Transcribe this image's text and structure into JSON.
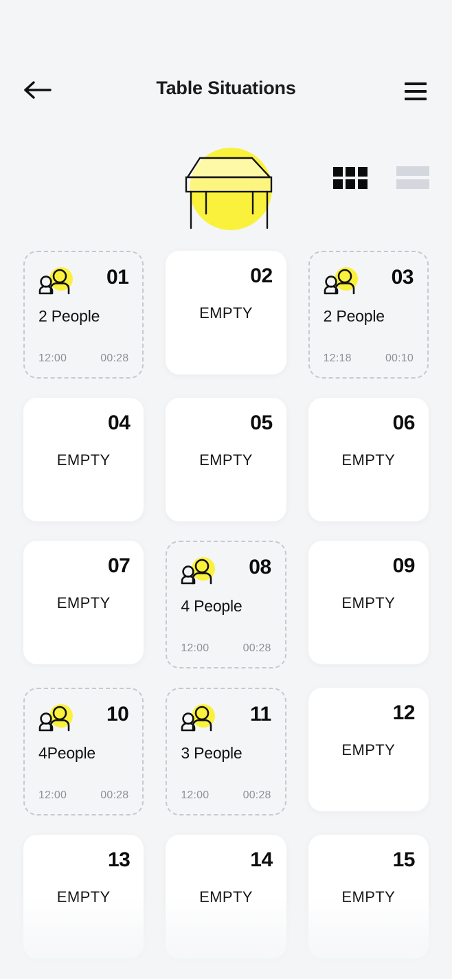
{
  "header": {
    "back_icon": "arrow-left-icon",
    "title": "Table Situations",
    "menu_icon": "hamburger-menu-icon"
  },
  "hero": {
    "illustration_name": "table-illustration",
    "accent_color": "#FAF13D",
    "toggles": [
      {
        "name": "grid-view-toggle",
        "icon": "grid-icon",
        "active": true
      },
      {
        "name": "list-view-toggle",
        "icon": "list-icon",
        "active": false
      }
    ]
  },
  "labels": {
    "empty_status": "EMPTY",
    "people_icon": "people-icon"
  },
  "tables": [
    {
      "number": "01",
      "occupied": true,
      "status": "2 People",
      "start": "12:00",
      "elapsed": "00:28"
    },
    {
      "number": "02",
      "occupied": false,
      "status": "EMPTY",
      "start": "",
      "elapsed": ""
    },
    {
      "number": "03",
      "occupied": true,
      "status": "2 People",
      "start": "12:18",
      "elapsed": "00:10"
    },
    {
      "number": "04",
      "occupied": false,
      "status": "EMPTY",
      "start": "",
      "elapsed": ""
    },
    {
      "number": "05",
      "occupied": false,
      "status": "EMPTY",
      "start": "",
      "elapsed": ""
    },
    {
      "number": "06",
      "occupied": false,
      "status": "EMPTY",
      "start": "",
      "elapsed": ""
    },
    {
      "number": "07",
      "occupied": false,
      "status": "EMPTY",
      "start": "",
      "elapsed": ""
    },
    {
      "number": "08",
      "occupied": true,
      "status": "4 People",
      "start": "12:00",
      "elapsed": "00:28"
    },
    {
      "number": "09",
      "occupied": false,
      "status": "EMPTY",
      "start": "",
      "elapsed": ""
    },
    {
      "number": "10",
      "occupied": true,
      "status": "4People",
      "start": "12:00",
      "elapsed": "00:28"
    },
    {
      "number": "11",
      "occupied": true,
      "status": "3 People",
      "start": "12:00",
      "elapsed": "00:28"
    },
    {
      "number": "12",
      "occupied": false,
      "status": "EMPTY",
      "start": "",
      "elapsed": ""
    },
    {
      "number": "13",
      "occupied": false,
      "status": "EMPTY",
      "start": "",
      "elapsed": ""
    },
    {
      "number": "14",
      "occupied": false,
      "status": "EMPTY",
      "start": "",
      "elapsed": ""
    },
    {
      "number": "15",
      "occupied": false,
      "status": "EMPTY",
      "start": "",
      "elapsed": ""
    }
  ]
}
